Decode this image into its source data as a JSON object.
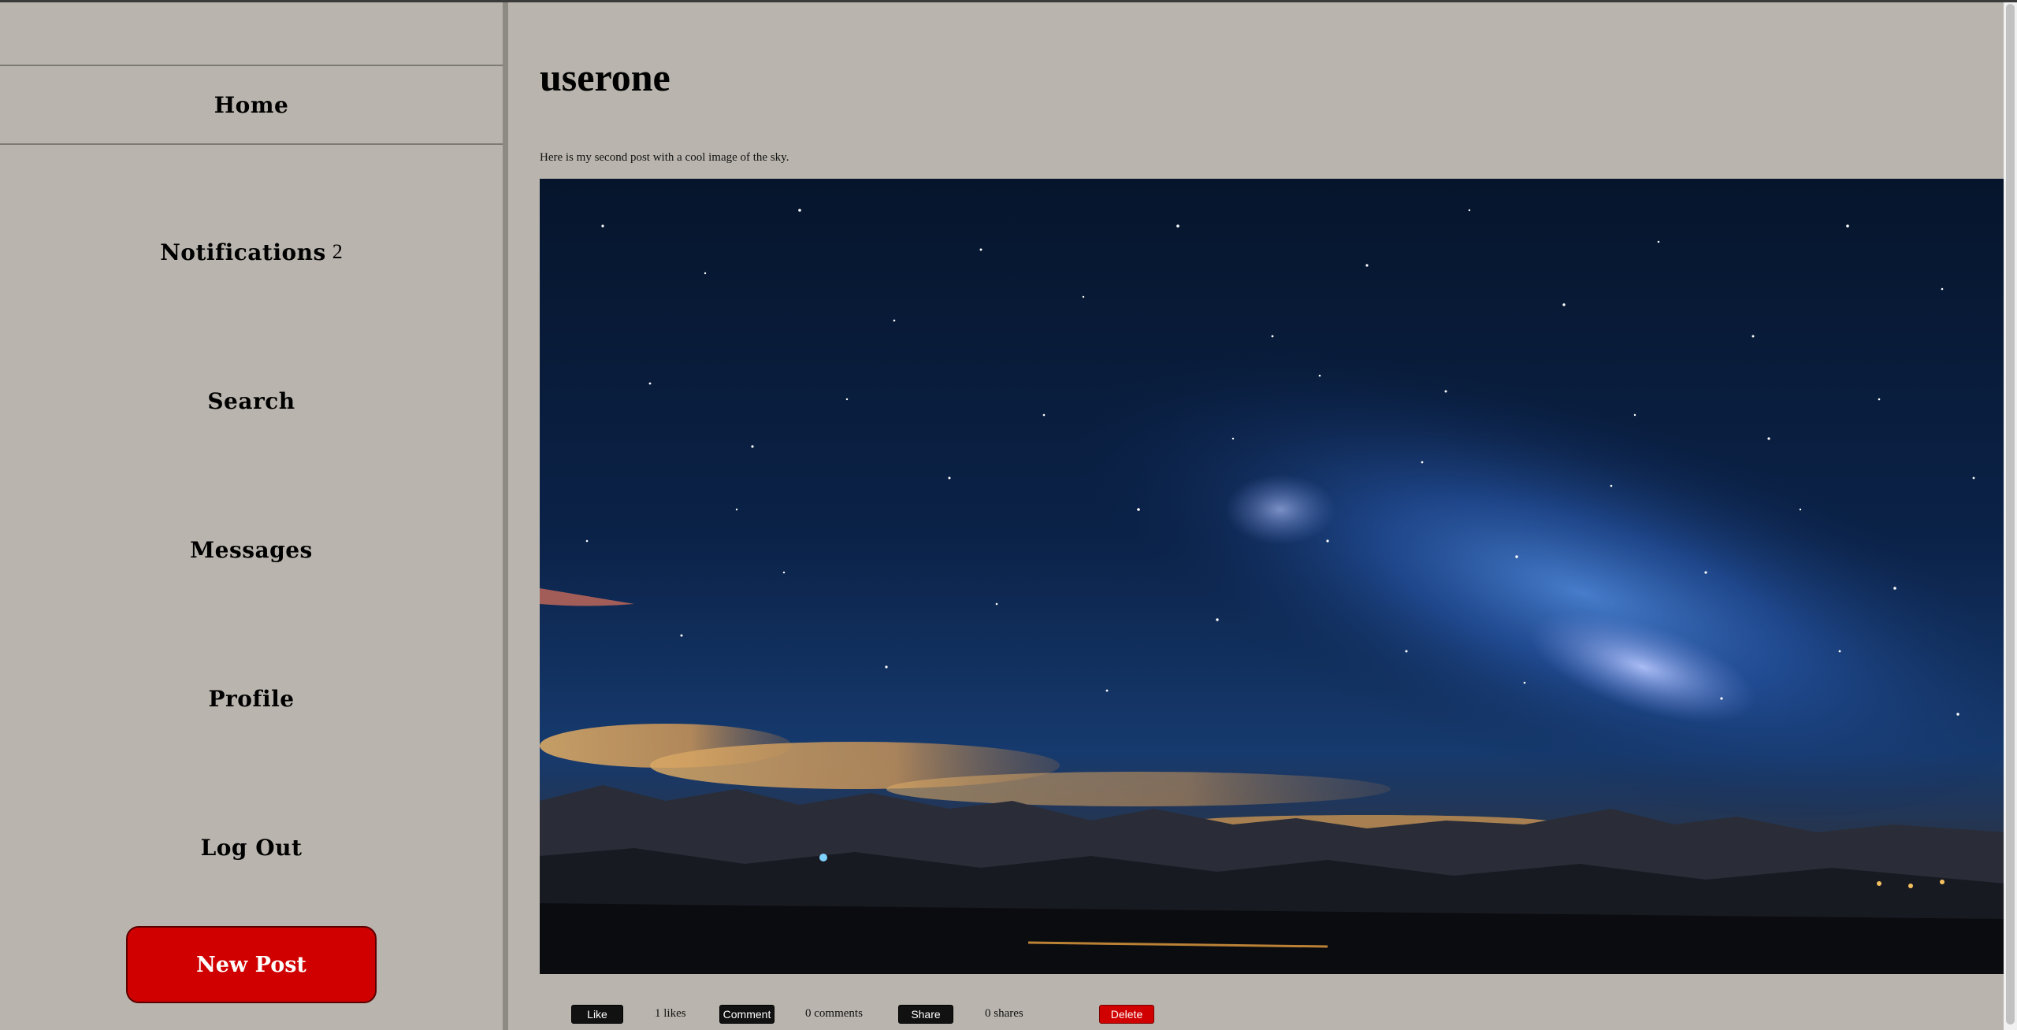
{
  "sidebar": {
    "items": [
      {
        "label": "Home"
      },
      {
        "label": "Notifications",
        "count": "2"
      },
      {
        "label": "Search"
      },
      {
        "label": "Messages"
      },
      {
        "label": "Profile"
      },
      {
        "label": "Log Out"
      }
    ],
    "new_post_label": "New Post"
  },
  "post": {
    "username": "userone",
    "caption": "Here is my second post with a cool image of the sky.",
    "image_icon": "night-sky-photo",
    "actions": {
      "like_label": "Like",
      "likes_text": "1 likes",
      "comment_label": "Comment",
      "comments_text": "0 comments",
      "share_label": "Share",
      "shares_text": "0 shares",
      "delete_label": "Delete"
    }
  },
  "colors": {
    "background": "#b9b5ae",
    "accent_red": "#d00000",
    "button_dark": "#111111"
  }
}
